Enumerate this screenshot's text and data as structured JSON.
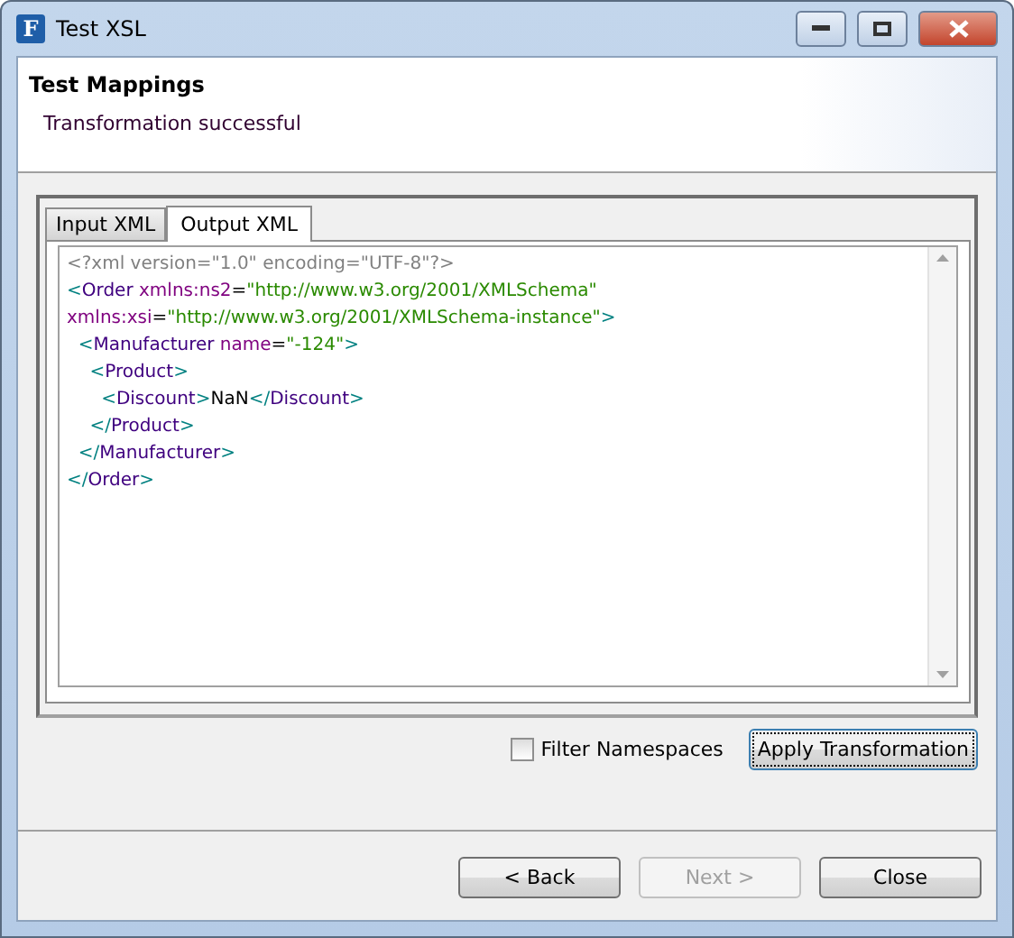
{
  "window": {
    "title": "Test XSL",
    "app_icon_letter": "F"
  },
  "header": {
    "title": "Test Mappings",
    "message": "Transformation successful"
  },
  "tabs": [
    {
      "label": "Input XML",
      "selected": false
    },
    {
      "label": "Output XML",
      "selected": true
    }
  ],
  "editor": {
    "lines": [
      [
        {
          "kind": "decl",
          "text": "<?xml version=\"1.0\" encoding=\"UTF-8\"?>"
        }
      ],
      [
        {
          "kind": "bracket",
          "text": "<"
        },
        {
          "kind": "tag",
          "text": "Order "
        },
        {
          "kind": "attr",
          "text": "xmlns:ns2"
        },
        {
          "kind": "text",
          "text": "="
        },
        {
          "kind": "value",
          "text": "\"http://www.w3.org/2001/XMLSchema\""
        }
      ],
      [
        {
          "kind": "attr",
          "text": "xmlns:xsi"
        },
        {
          "kind": "text",
          "text": "="
        },
        {
          "kind": "value",
          "text": "\"http://www.w3.org/2001/XMLSchema-instance\""
        },
        {
          "kind": "bracket",
          "text": ">"
        }
      ],
      [
        {
          "kind": "bracket",
          "text": "  <"
        },
        {
          "kind": "tag",
          "text": "Manufacturer "
        },
        {
          "kind": "attr",
          "text": "name"
        },
        {
          "kind": "text",
          "text": "="
        },
        {
          "kind": "value",
          "text": "\"-124\""
        },
        {
          "kind": "bracket",
          "text": ">"
        }
      ],
      [
        {
          "kind": "bracket",
          "text": "    <"
        },
        {
          "kind": "tag",
          "text": "Product"
        },
        {
          "kind": "bracket",
          "text": ">"
        }
      ],
      [
        {
          "kind": "bracket",
          "text": "      <"
        },
        {
          "kind": "tag",
          "text": "Discount"
        },
        {
          "kind": "bracket",
          "text": ">"
        },
        {
          "kind": "text",
          "text": "NaN"
        },
        {
          "kind": "bracket",
          "text": "</"
        },
        {
          "kind": "tag",
          "text": "Discount"
        },
        {
          "kind": "bracket",
          "text": ">"
        }
      ],
      [
        {
          "kind": "bracket",
          "text": "    </"
        },
        {
          "kind": "tag",
          "text": "Product"
        },
        {
          "kind": "bracket",
          "text": ">"
        }
      ],
      [
        {
          "kind": "bracket",
          "text": "  </"
        },
        {
          "kind": "tag",
          "text": "Manufacturer"
        },
        {
          "kind": "bracket",
          "text": ">"
        }
      ],
      [
        {
          "kind": "bracket",
          "text": "</"
        },
        {
          "kind": "tag",
          "text": "Order"
        },
        {
          "kind": "bracket",
          "text": ">"
        }
      ]
    ]
  },
  "filter_namespaces": {
    "label": "Filter Namespaces",
    "checked": false
  },
  "apply_button": {
    "label": "Apply Transformation"
  },
  "buttons": [
    {
      "label": "< Back",
      "disabled": false
    },
    {
      "label": "Next >",
      "disabled": true
    },
    {
      "label": "Close",
      "disabled": false
    }
  ]
}
